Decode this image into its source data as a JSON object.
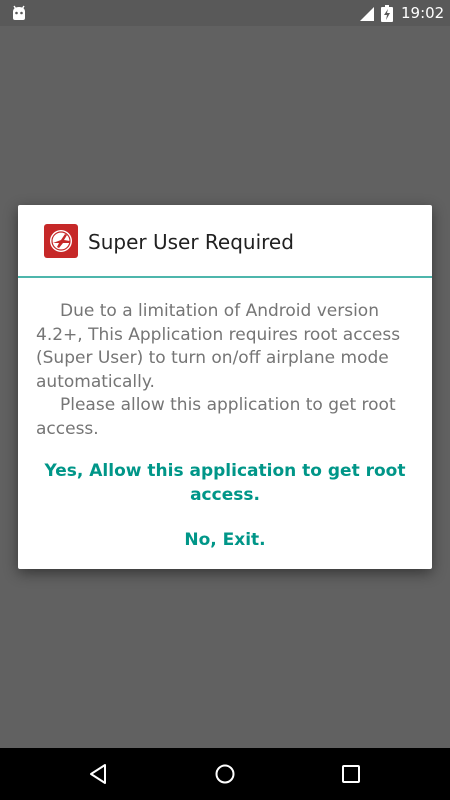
{
  "status_bar": {
    "time": "19:02",
    "left_icon": "android-debug-icon",
    "signal_icon": "signal-icon",
    "battery_icon": "battery-charging-icon"
  },
  "dialog": {
    "icon": "airplane-mode-app-icon",
    "title": "Super User Required",
    "message_paragraphs": [
      "Due to a limitation of Android version 4.2+, This Application requires root access (Super User) to turn on/off airplane mode automatically.",
      "Please allow this application to get root access."
    ],
    "actions": {
      "yes_label": "Yes, Allow this application to get root access.",
      "no_label": "No, Exit."
    },
    "accent_color": "#009688",
    "divider_color": "#4db6ac"
  },
  "nav_bar": {
    "back_icon": "back-icon",
    "home_icon": "home-icon",
    "recents_icon": "recents-icon"
  },
  "colors": {
    "scrim": "#616161",
    "dialog_background": "#ffffff",
    "message_text": "#757575"
  }
}
